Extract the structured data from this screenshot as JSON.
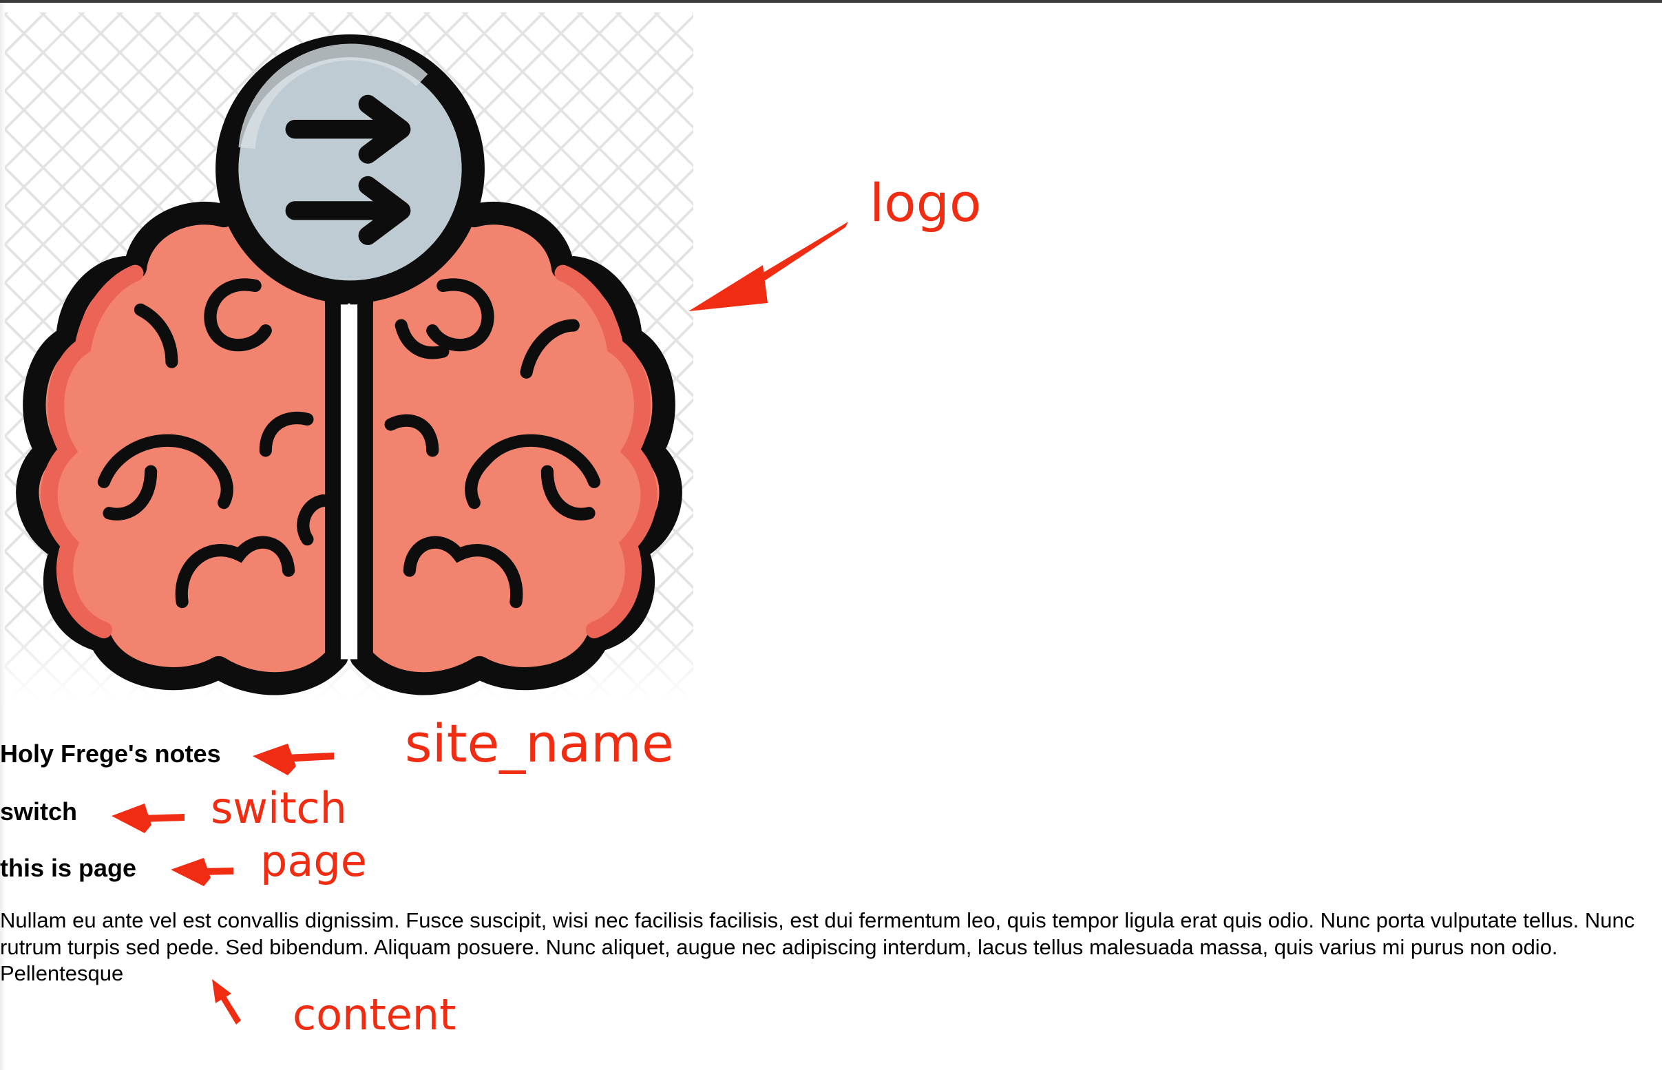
{
  "site_name": "Holy Frege's notes",
  "switch": "switch",
  "page": "this is page",
  "content": "Nullam eu ante vel est convallis dignissim. Fusce suscipit, wisi nec facilisis facilisis, est dui fermentum leo, quis tempor ligula erat quis odio. Nunc porta vulputate tellus. Nunc rutrum turpis sed pede. Sed bibendum. Aliquam posuere. Nunc aliquet, augue nec adipiscing interdum, lacus tellus malesuada massa, quis varius mi purus non odio. Pellentesque",
  "annotations": {
    "logo": "logo",
    "site_name": "site_name",
    "switch": "switch",
    "page": "page",
    "content": "content"
  },
  "logo": {
    "icon": "brain-arrows-icon"
  },
  "colors": {
    "annotation": "#f02d12",
    "brain": "#f2836f",
    "brain_shade": "#ec6455",
    "circle": "#bfcbd2",
    "outline": "#0d0d0d"
  }
}
